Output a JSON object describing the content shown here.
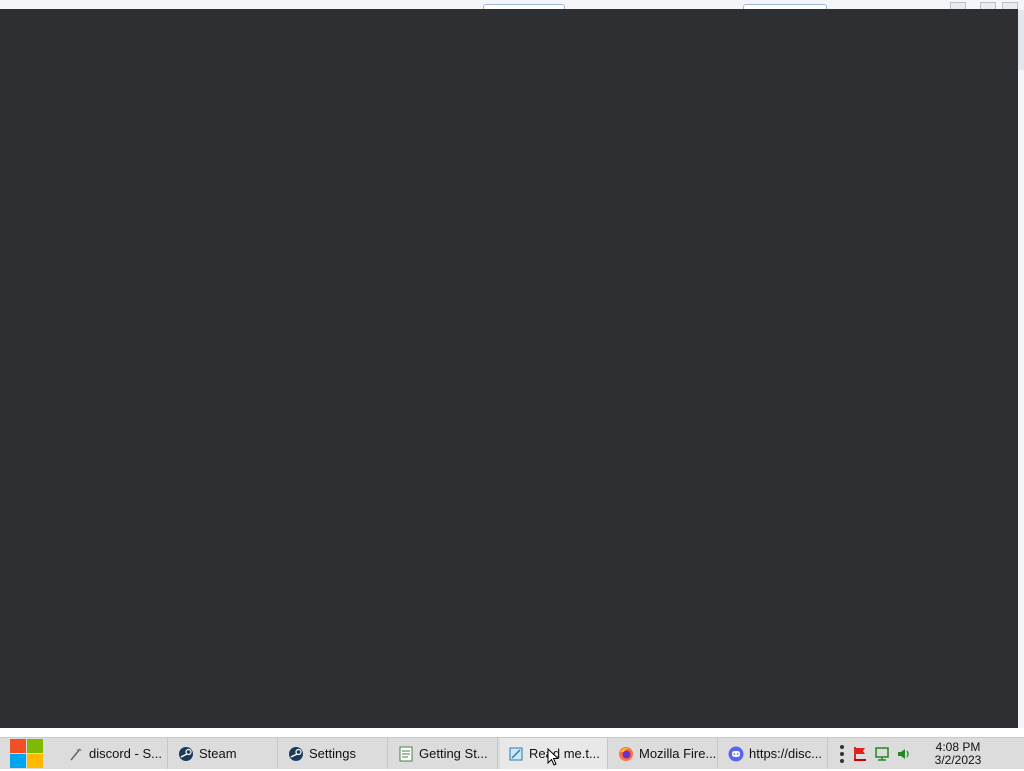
{
  "taskbar": {
    "items": [
      {
        "label": "discord - S...",
        "icon": "feather-icon"
      },
      {
        "label": "Steam",
        "icon": "steam-icon"
      },
      {
        "label": "Settings",
        "icon": "steam-icon"
      },
      {
        "label": "Getting St...",
        "icon": "document-icon"
      },
      {
        "label": "Read me.t...",
        "icon": "notepad-icon"
      },
      {
        "label": "Mozilla Fire...",
        "icon": "firefox-icon"
      },
      {
        "label": "https://disc...",
        "icon": "discord-icon"
      }
    ]
  },
  "clock": {
    "time": "4:08 PM",
    "date": "3/2/2023"
  },
  "colors": {
    "app_background": "#2e2f33",
    "taskbar": "#dcdcdc"
  }
}
